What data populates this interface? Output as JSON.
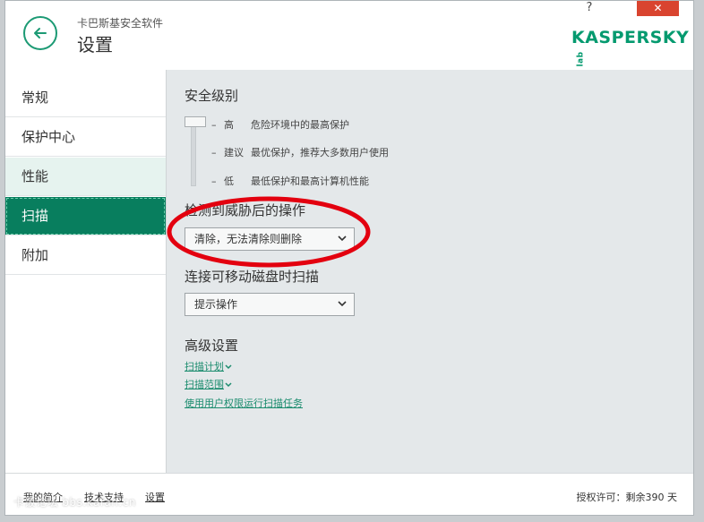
{
  "header": {
    "app_name": "卡巴斯基安全软件",
    "page_title": "设置",
    "help_label": "?",
    "close_label": "✕",
    "logo_text": "KASPERSKY",
    "logo_suffix": "lab"
  },
  "sidebar": {
    "items": [
      {
        "label": "常规",
        "state": "normal"
      },
      {
        "label": "保护中心",
        "state": "normal"
      },
      {
        "label": "性能",
        "state": "hover"
      },
      {
        "label": "扫描",
        "state": "active"
      },
      {
        "label": "附加",
        "state": "normal"
      }
    ]
  },
  "security_level": {
    "title": "安全级别",
    "levels": [
      {
        "name": "高",
        "desc": "危险环境中的最高保护"
      },
      {
        "name": "建议",
        "desc": "最优保护，推荐大多数用户使用"
      },
      {
        "name": "低",
        "desc": "最低保护和最高计算机性能"
      }
    ],
    "selected": "高"
  },
  "threat_action": {
    "title": "检测到威胁后的操作",
    "value": "清除，无法清除则删除"
  },
  "removable_scan": {
    "title": "连接可移动磁盘时扫描",
    "value": "提示操作"
  },
  "advanced": {
    "title": "高级设置",
    "links": [
      "扫描计划",
      "扫描范围",
      "使用用户权限运行扫描任务"
    ]
  },
  "footer": {
    "links": [
      "我的简介",
      "技术支持",
      "设置"
    ],
    "license": "授权许可：剩余390 天"
  },
  "watermark": "卡饭论坛 bbs.kafan.cn",
  "colors": {
    "accent": "#049a6f",
    "active_nav": "#087e5e",
    "close_button": "#d9442f",
    "annotation": "#e3000f"
  }
}
